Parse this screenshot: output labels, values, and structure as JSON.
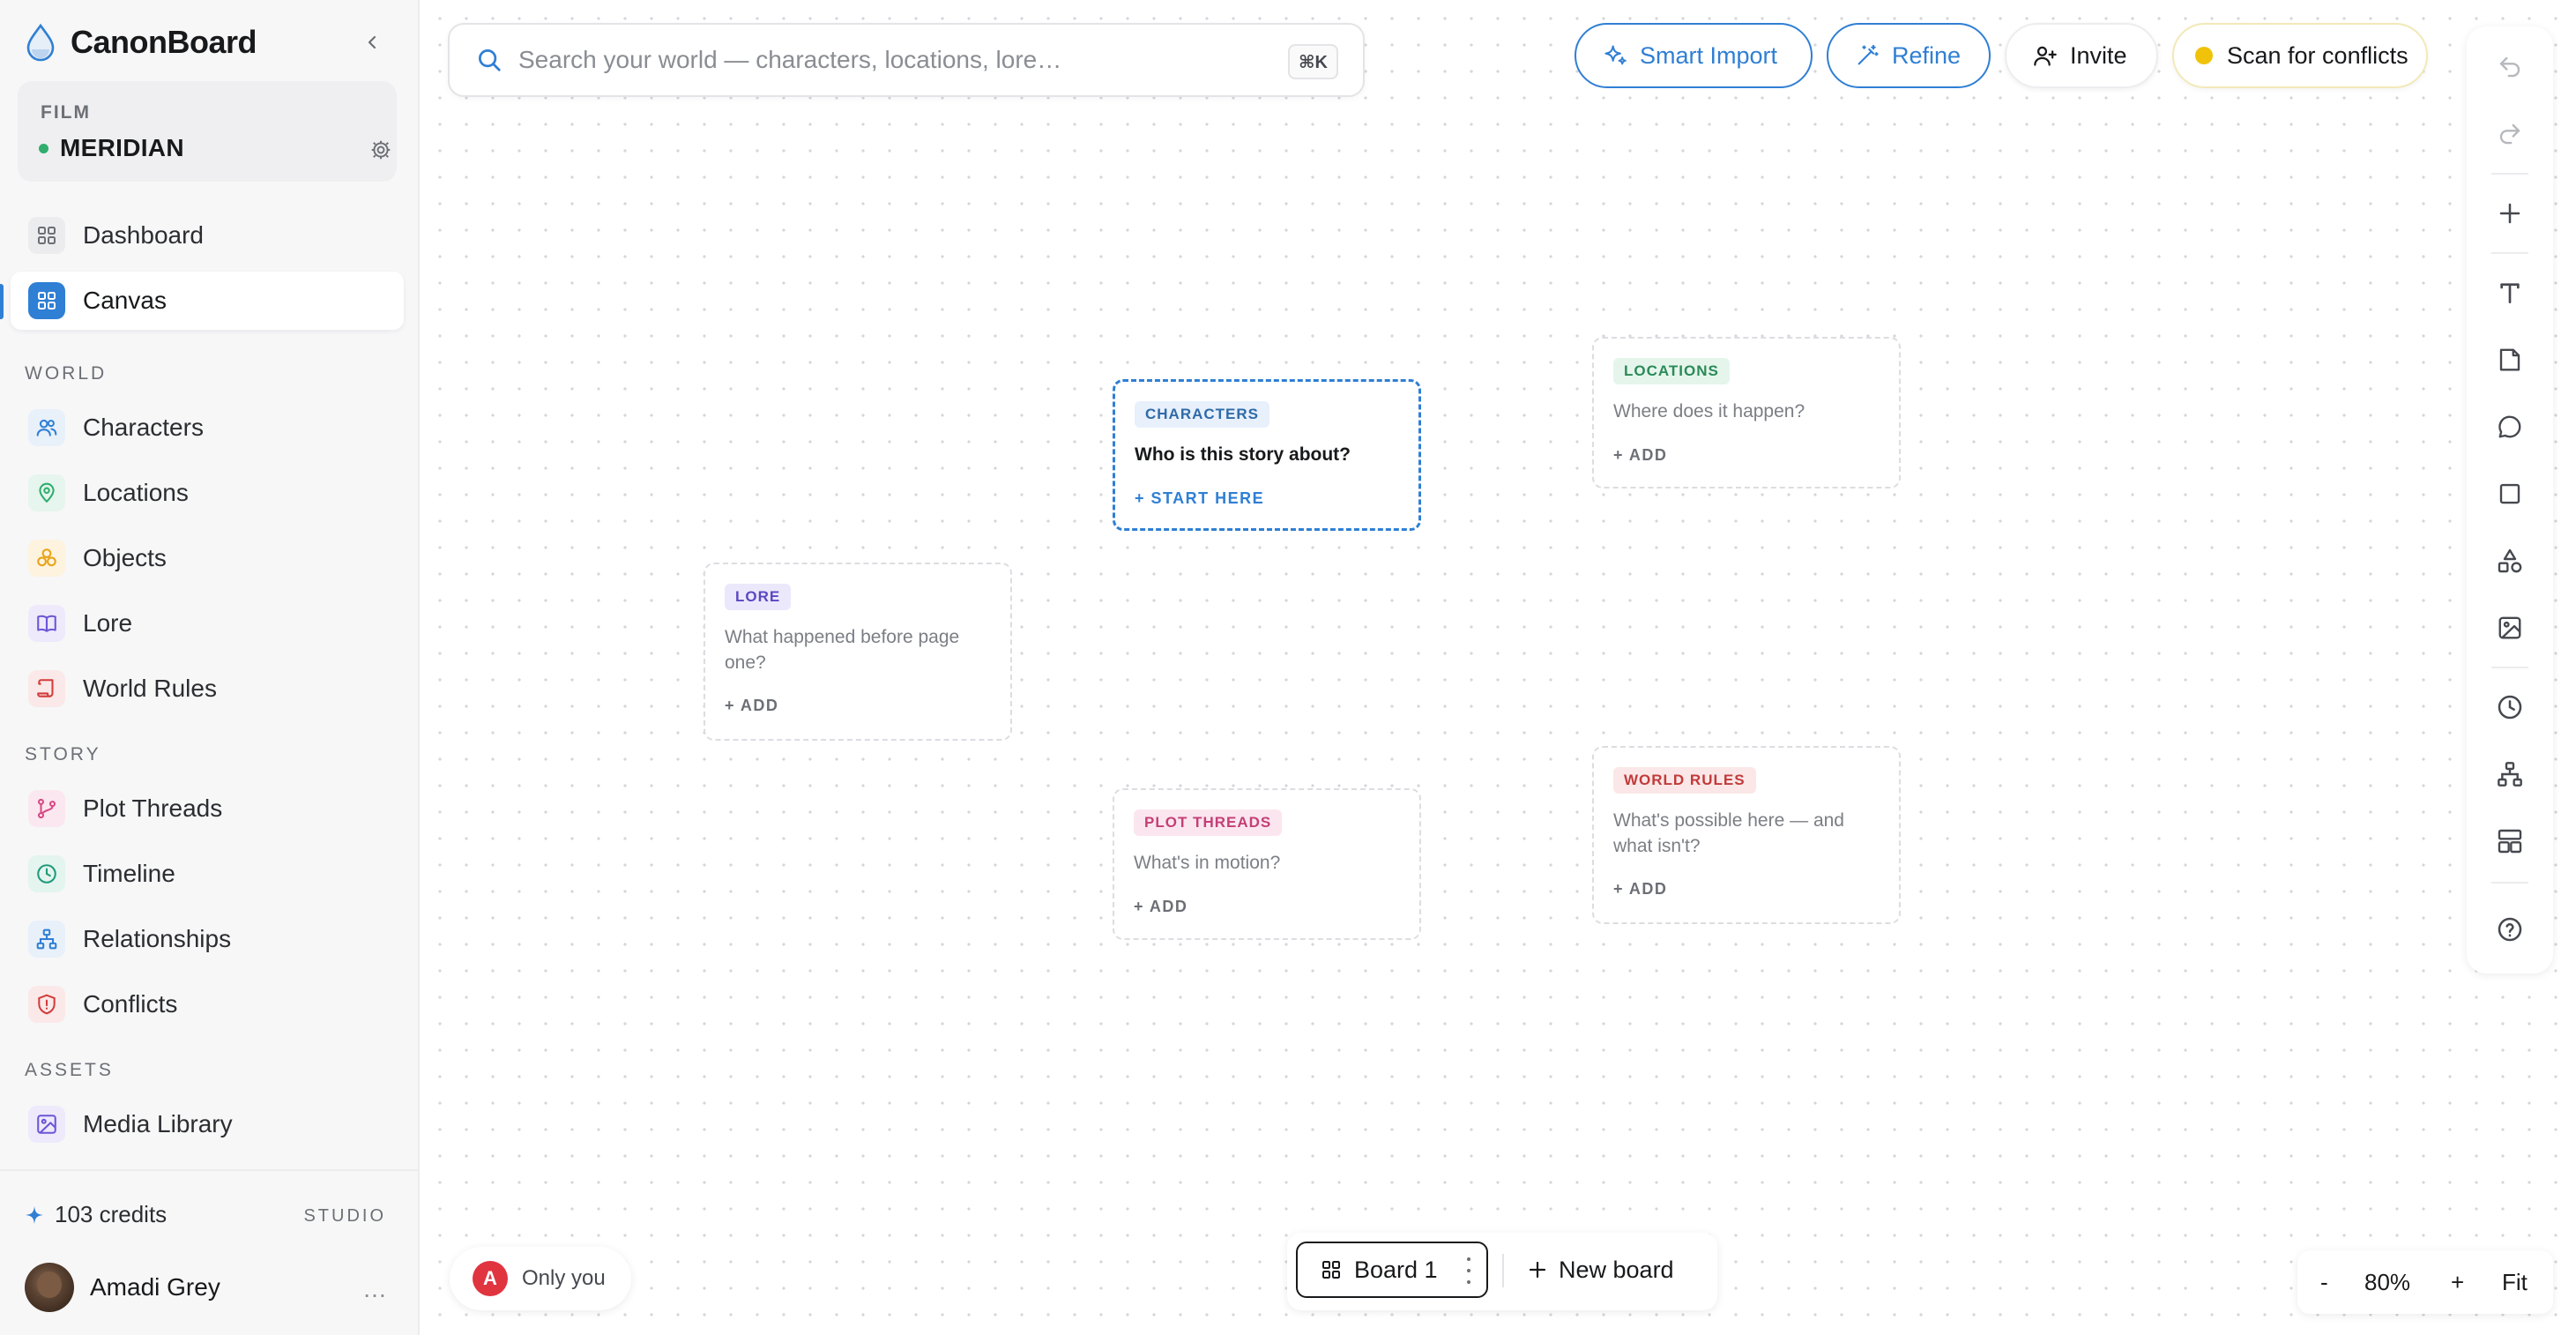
{
  "app": {
    "name": "CanonBoard"
  },
  "project": {
    "type": "FILM",
    "name": "MERIDIAN",
    "status_color": "#2fae6e"
  },
  "nav": {
    "top": [
      {
        "label": "Dashboard",
        "icon": "dashboard-icon"
      },
      {
        "label": "Canvas",
        "icon": "canvas-grid-icon",
        "active": true
      }
    ],
    "world_label": "WORLD",
    "world": [
      {
        "label": "Characters",
        "icon": "users-icon"
      },
      {
        "label": "Locations",
        "icon": "map-pin-icon"
      },
      {
        "label": "Objects",
        "icon": "objects-icon"
      },
      {
        "label": "Lore",
        "icon": "book-icon"
      },
      {
        "label": "World Rules",
        "icon": "scroll-icon"
      }
    ],
    "story_label": "STORY",
    "story": [
      {
        "label": "Plot Threads",
        "icon": "branch-icon"
      },
      {
        "label": "Timeline",
        "icon": "clock-icon"
      },
      {
        "label": "Relationships",
        "icon": "network-icon"
      },
      {
        "label": "Conflicts",
        "icon": "shield-alert-icon"
      }
    ],
    "assets_label": "ASSETS",
    "assets": [
      {
        "label": "Media Library",
        "icon": "image-icon"
      }
    ]
  },
  "footer": {
    "credits": "103 credits",
    "plan": "STUDIO",
    "user_name": "Amadi Grey",
    "more": "…"
  },
  "search": {
    "placeholder": "Search your world — characters, locations, lore…",
    "shortcut": "⌘K"
  },
  "toolbar": {
    "smart_import": "Smart Import",
    "refine": "Refine",
    "invite": "Invite",
    "scan": "Scan for conflicts"
  },
  "cards": {
    "characters": {
      "tag": "CHARACTERS",
      "question": "Who is this story about?",
      "action": "+ START HERE"
    },
    "locations": {
      "tag": "LOCATIONS",
      "question": "Where does it happen?",
      "action": "+ ADD"
    },
    "lore": {
      "tag": "LORE",
      "question": "What happened before page one?",
      "action": "+ ADD"
    },
    "plot_threads": {
      "tag": "PLOT THREADS",
      "question": "What's in motion?",
      "action": "+ ADD"
    },
    "world_rules": {
      "tag": "WORLD RULES",
      "question": "What's possible here — and what isn't?",
      "action": "+ ADD"
    }
  },
  "presence": {
    "initial": "A",
    "label": "Only you"
  },
  "boards": {
    "current": "Board 1",
    "new_label": "New board"
  },
  "zoom": {
    "minus": "-",
    "level": "80%",
    "plus": "+",
    "fit": "Fit"
  },
  "colors": {
    "accent": "#2f7fd4",
    "characters_tag_bg": "#e7f0fb",
    "characters_tag_fg": "#2f6aa8",
    "locations_tag_bg": "#e5f5ec",
    "locations_tag_fg": "#2a8a57",
    "lore_tag_bg": "#ece8fb",
    "lore_tag_fg": "#5b47c2",
    "plot_tag_bg": "#fbe6ef",
    "plot_tag_fg": "#c43f76",
    "rules_tag_bg": "#fbe7e7",
    "rules_tag_fg": "#c23a3a",
    "scan_dot": "#f0c20a"
  }
}
